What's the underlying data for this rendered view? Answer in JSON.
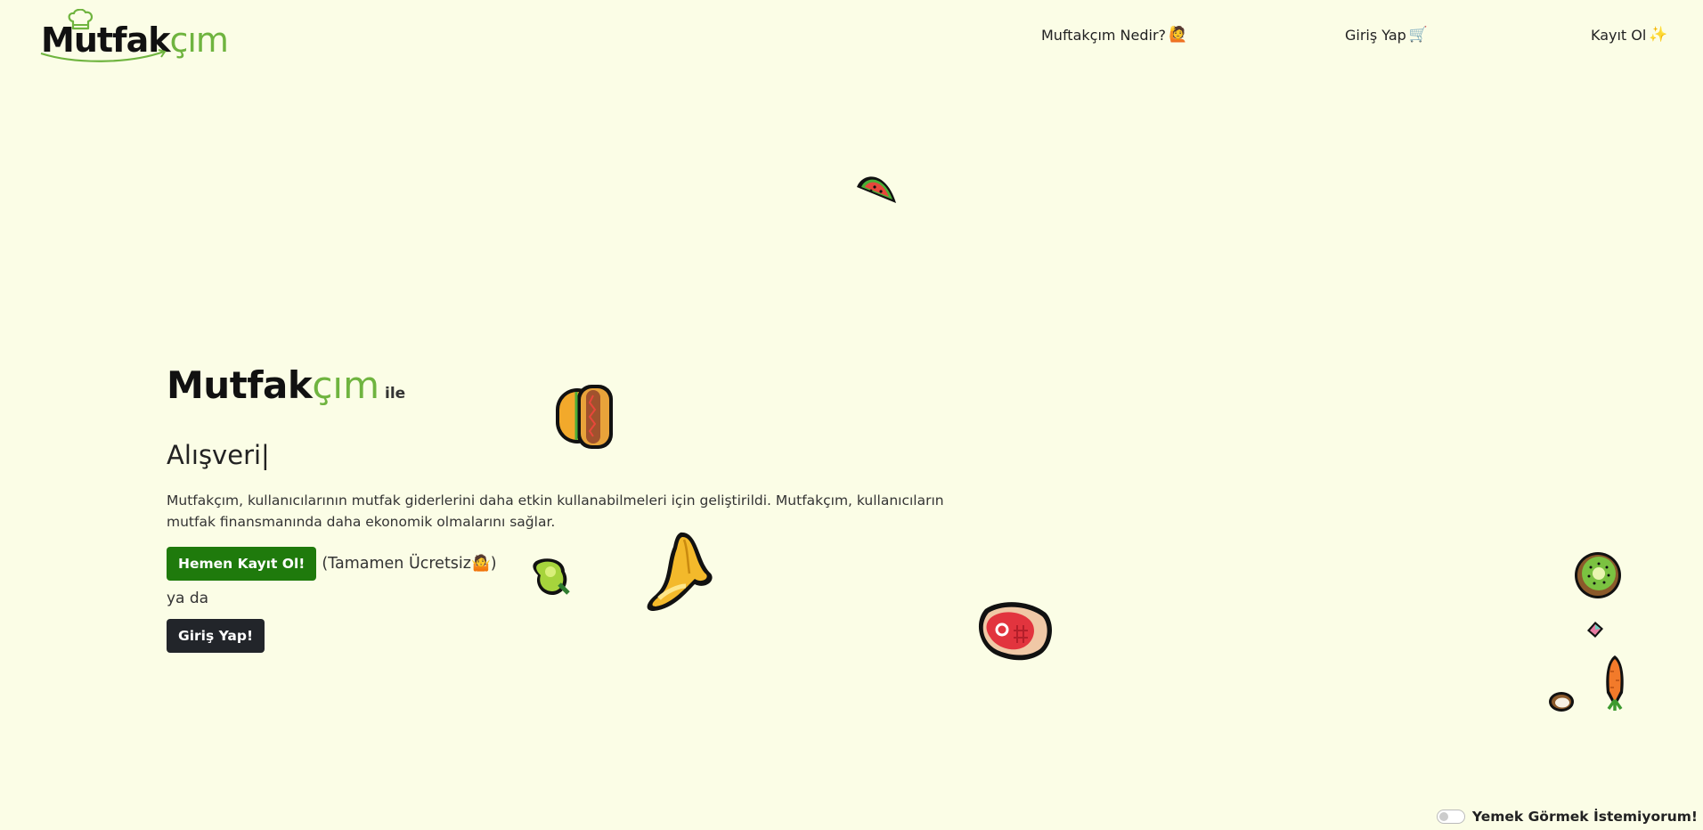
{
  "header": {
    "logo": {
      "bold": "Mutfak",
      "light": "çım"
    },
    "nav": [
      {
        "label": "Muftakçım Nedir?",
        "emoji": "🙋"
      },
      {
        "label": "Giriş Yap",
        "emoji": "🛒"
      },
      {
        "label": "Kayıt Ol",
        "emoji": "✨"
      }
    ]
  },
  "hero": {
    "brand_bold": "Mutfak",
    "brand_light": "çım",
    "brand_suffix": "ile",
    "typed_text": "Alışveri|",
    "description": "Mutfakçım, kullanıcılarının mutfak giderlerini daha etkin kullanabilmeleri için geliştirildi. Mutfakçım, kullanıcıların mutfak finansmanında daha ekonomik olmalarını sağlar.",
    "register_button": "Hemen Kayıt Ol!",
    "free_note_open": "(Tamamen Ücretsiz",
    "free_note_emoji": "🤷",
    "free_note_close": ")",
    "or_text": "ya da",
    "login_button": "Giriş Yap!"
  },
  "food_icons": [
    "watermelon-icon",
    "hotdog-icon",
    "pear-icon",
    "banana-icon",
    "steak-icon",
    "kiwi-icon",
    "candy-icon",
    "carrot-icon",
    "coconut-icon"
  ],
  "footer_toggle": {
    "label": "Yemek Görmek İstemiyorum!",
    "checked": false
  },
  "colors": {
    "background": "#fbfde6",
    "accent_green": "#6fb43f",
    "register_button": "#1f7a0c",
    "login_button": "#22252a"
  }
}
